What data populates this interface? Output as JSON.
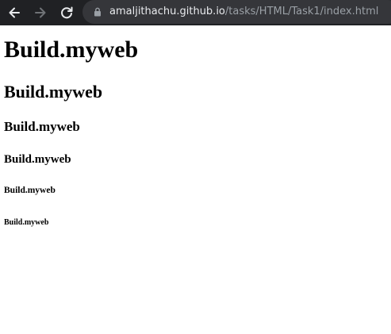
{
  "browser": {
    "url_host": "amaljithachu.github.io",
    "url_path": "/tasks/HTML/Task1/index.html",
    "icons": {
      "back": "back-arrow-icon",
      "forward": "forward-arrow-icon",
      "reload": "reload-icon",
      "lock": "lock-icon"
    },
    "colors": {
      "toolbar": "#202124",
      "omnibox": "#35363a",
      "host_text": "#e8eaed",
      "path_text": "#9aa0a6"
    }
  },
  "page": {
    "headings": {
      "h1": "Build.myweb",
      "h2": "Build.myweb",
      "h3": "Build.myweb",
      "h4": "Build.myweb",
      "h5": "Build.myweb",
      "h6": "Build.myweb"
    }
  }
}
